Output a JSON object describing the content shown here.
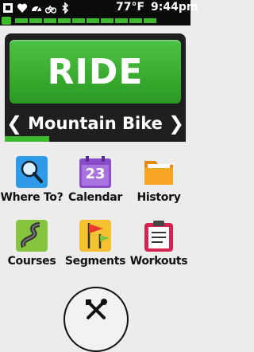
{
  "status": {
    "temperature": "77°F",
    "time": "9:44pm",
    "icons": [
      "satellite-icon",
      "heart-icon",
      "speed-sensor-icon",
      "cycling-icon",
      "bluetooth-icon"
    ],
    "battery_segments": 10
  },
  "activity": {
    "action_label": "RIDE",
    "profile_name": "Mountain Bike",
    "prev_symbol": "❮",
    "next_symbol": "❯",
    "profile_count": 4,
    "active_profile_index": 1
  },
  "apps": [
    {
      "label": "Where To?",
      "icon": "search-icon"
    },
    {
      "label": "Calendar",
      "icon": "calendar-icon",
      "icon_text": "23"
    },
    {
      "label": "History",
      "icon": "folder-icon"
    },
    {
      "label": "Courses",
      "icon": "course-map-icon"
    },
    {
      "label": "Segments",
      "icon": "segments-flag-icon"
    },
    {
      "label": "Workouts",
      "icon": "clipboard-icon"
    }
  ],
  "tools": {
    "icon": "tools-icon"
  },
  "colors": {
    "accent": "#3dbb2c",
    "background": "#ececec",
    "panel": "#1f1f1f"
  }
}
